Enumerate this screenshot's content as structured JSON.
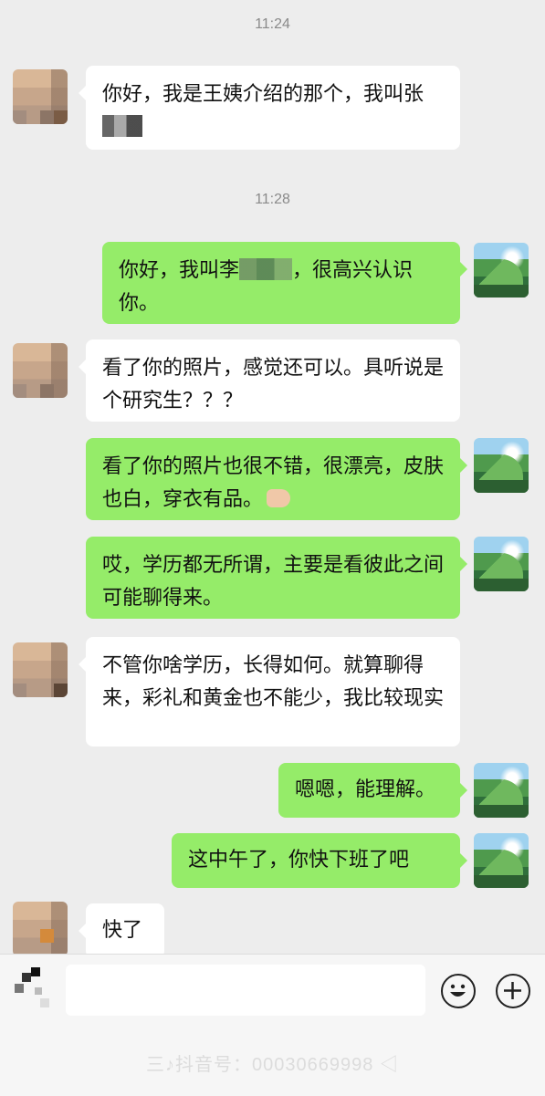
{
  "chat": {
    "timestamps": [
      "11:24",
      "11:28"
    ],
    "messages": [
      {
        "side": "left",
        "text": "你好，我是王姨介绍的那个，我叫张",
        "redacted": true
      },
      {
        "side": "right",
        "text_before": "你好，我叫李",
        "text_after": "，很高兴认识你。",
        "redacted": true
      },
      {
        "side": "left",
        "text": "看了你的照片，感觉还可以。具听说是个研究生？？？"
      },
      {
        "side": "right",
        "text": "看了你的照片也很不错，很漂亮，皮肤也白，穿衣有品。",
        "emoji": "thumbs-up"
      },
      {
        "side": "right",
        "text": "哎，学历都无所谓，主要是看彼此之间可能聊得来。"
      },
      {
        "side": "left",
        "text": "不管你啥学历，长得如何。就算聊得来，彩礼和黄金也不能少，我比较现实"
      },
      {
        "side": "right",
        "text": "嗯嗯，能理解。"
      },
      {
        "side": "right",
        "text": "这中午了，你快下班了吧"
      },
      {
        "side": "left",
        "text": "快了"
      }
    ]
  },
  "input": {
    "placeholder": "",
    "icons": [
      "voice-icon",
      "emoji-icon",
      "plus-icon"
    ]
  },
  "watermark": {
    "text": "三♪抖音号：00030669998 ◁"
  },
  "colors": {
    "background": "#ededed",
    "bubble_self": "#95ec69",
    "bubble_other": "#ffffff"
  }
}
